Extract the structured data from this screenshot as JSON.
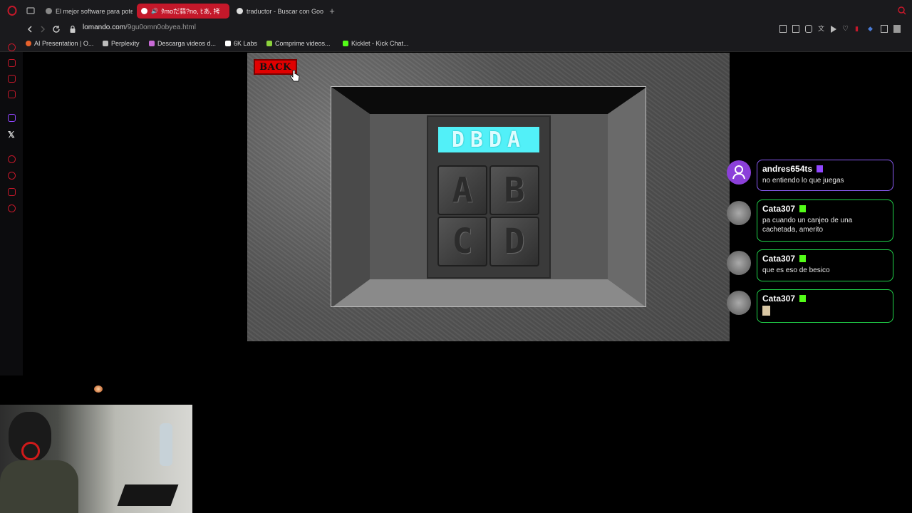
{
  "browser": {
    "tabs": [
      {
        "label": "El mejor software para pote",
        "active": false
      },
      {
        "label": "ﾀmoだ蒜?no, ﾋあ, 拷",
        "active": true
      },
      {
        "label": "traductor - Buscar con Goo",
        "active": false
      }
    ],
    "new_tab_label": "+",
    "url_host": "lomando.com",
    "url_path": "/9gu0omn0obyea.html",
    "bookmarks": [
      {
        "label": "AI Presentation | O...",
        "color": "#e8622c"
      },
      {
        "label": "Perplexity",
        "color": "#bbbbbb"
      },
      {
        "label": "Descarga videos d...",
        "color": "#c86ad6"
      },
      {
        "label": "6K Labs",
        "color": "#ffffff"
      },
      {
        "label": "Comprime videos...",
        "color": "#8cd23c"
      },
      {
        "label": "Kicklet - Kick Chat...",
        "color": "#53fc18"
      }
    ]
  },
  "game": {
    "back_label": "BACK",
    "display_code": "DBDA",
    "keys": [
      "A",
      "B",
      "C",
      "D"
    ]
  },
  "chat": {
    "messages": [
      {
        "user": "andres654ts",
        "text": "no entiendo lo que juegas",
        "platform": "twitch",
        "border": "#8b5cf6"
      },
      {
        "user": "Cata307",
        "text": "pa cuando un canjeo de una cachetada, amerito",
        "platform": "kick",
        "border": "#21d44a"
      },
      {
        "user": "Cata307",
        "text": "que es eso de besico",
        "platform": "kick",
        "border": "#21d44a"
      },
      {
        "user": "Cata307",
        "text": "",
        "platform": "kick",
        "border": "#21d44a"
      }
    ]
  },
  "colors": {
    "browser_accent": "#c4182a",
    "display": "#52f0f8",
    "back_button": "#e10000",
    "kick_green": "#53fc18",
    "twitch_purple": "#9146ff"
  }
}
